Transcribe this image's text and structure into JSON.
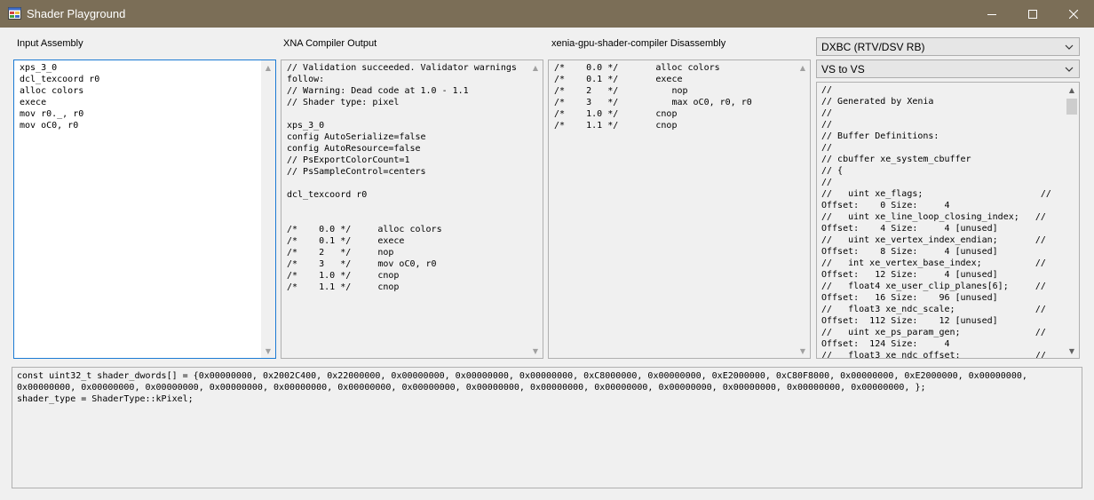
{
  "window": {
    "title": "Shader Playground"
  },
  "labels": {
    "input": "Input Assembly",
    "xna": "XNA Compiler Output",
    "disasm": "xenia-gpu-shader-compiler Disassembly"
  },
  "combos": {
    "translation": "DXBC (RTV/DSV RB)",
    "shader_mode": "VS to VS"
  },
  "panes": {
    "input": "xps_3_0\ndcl_texcoord r0\nalloc colors\nexece\nmov r0._, r0\nmov oC0, r0",
    "xna": "// Validation succeeded. Validator warnings\nfollow:\n// Warning: Dead code at 1.0 - 1.1\n// Shader type: pixel\n\nxps_3_0\nconfig AutoSerialize=false\nconfig AutoResource=false\n// PsExportColorCount=1\n// PsSampleControl=centers\n\ndcl_texcoord r0\n\n\n/*    0.0 */     alloc colors\n/*    0.1 */     exece\n/*    2   */     nop\n/*    3   */     mov oC0, r0\n/*    1.0 */     cnop\n/*    1.1 */     cnop",
    "disasm": "/*    0.0 */       alloc colors\n/*    0.1 */       exece\n/*    2   */          nop\n/*    3   */          max oC0, r0, r0\n/*    1.0 */       cnop\n/*    1.1 */       cnop",
    "dxbc": "//\n// Generated by Xenia\n//\n//\n// Buffer Definitions:\n//\n// cbuffer xe_system_cbuffer\n// {\n//\n//   uint xe_flags;                      //\nOffset:    0 Size:     4\n//   uint xe_line_loop_closing_index;   //\nOffset:    4 Size:     4 [unused]\n//   uint xe_vertex_index_endian;       //\nOffset:    8 Size:     4 [unused]\n//   int xe_vertex_base_index;          //\nOffset:   12 Size:     4 [unused]\n//   float4 xe_user_clip_planes[6];     //\nOffset:   16 Size:    96 [unused]\n//   float3 xe_ndc_scale;               //\nOffset:  112 Size:    12 [unused]\n//   uint xe_ps_param_gen;              //\nOffset:  124 Size:     4\n//   float3 xe_ndc_offset;              //",
    "dwords": "const uint32_t shader_dwords[] = {0x00000000, 0x2002C400, 0x22000000, 0x00000000, 0x00000000, 0x00000000, 0xC8000000, 0x00000000, 0xE2000000, 0xC80F8000, 0x00000000, 0xE2000000, 0x00000000,\n0x00000000, 0x00000000, 0x00000000, 0x00000000, 0x00000000, 0x00000000, 0x00000000, 0x00000000, 0x00000000, 0x00000000, 0x00000000, 0x00000000, 0x00000000, 0x00000000, };\nshader_type = ShaderType::kPixel;"
  }
}
